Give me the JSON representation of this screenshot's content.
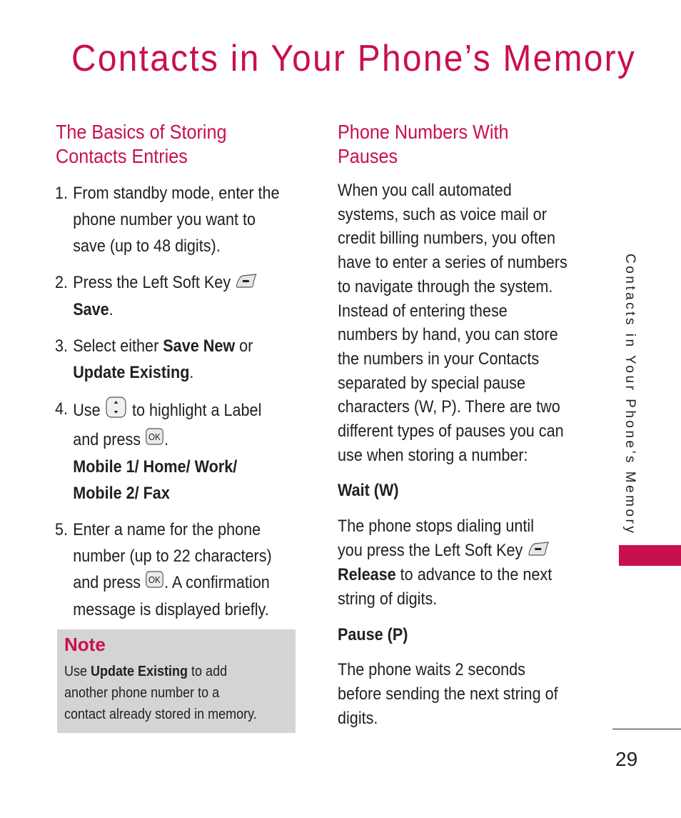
{
  "page": {
    "title": "Contacts in Your Phone’s Memory",
    "accent_color": "#c8104e",
    "side_tab": "Contacts in Your Phone’s Memory",
    "page_number": "29"
  },
  "left_section": {
    "heading_line1": "The Basics of Storing",
    "heading_line2": "Contacts Entries",
    "steps": [
      {
        "num": "1.",
        "lines": [
          "From standby mode, enter the",
          "phone number you want to",
          "save (up to 48 digits)."
        ]
      },
      {
        "num": "2.",
        "line1": "Press the Left Soft Key",
        "bold": "Save",
        "after": "."
      },
      {
        "num": "3.",
        "pre": "Select either ",
        "bold1": "Save New",
        "mid": " or",
        "bold2": "Update Existing",
        "after": "."
      },
      {
        "num": "4.",
        "pre": "Use",
        "post": "to highlight a Label",
        "line2_pre": "and press",
        "line2_post": ".",
        "labels_line1": "Mobile 1/ Home/ Work/",
        "labels_line2": "Mobile 2/ Fax"
      },
      {
        "num": "5.",
        "line1": "Enter a name for the phone",
        "line2": "number (up to 22 characters)",
        "line3_pre": "and press",
        "line3_post": ". A confirmation",
        "line4": "message is displayed briefly."
      }
    ],
    "note": {
      "title": "Note",
      "pre": "Use ",
      "bold": "Update Existing",
      "post": " to add",
      "line2": "another phone number to a",
      "line3": "contact already stored in memory."
    }
  },
  "right_section": {
    "heading_line1": "Phone Numbers With",
    "heading_line2": "Pauses",
    "intro_lines": [
      "When you call automated",
      "systems, such as voice mail or",
      "credit billing numbers, you often",
      "have to enter a series of numbers",
      "to navigate through the system.",
      "Instead of entering these",
      "numbers by hand, you can store",
      "the numbers in your Contacts",
      "separated by special pause",
      "characters (W, P). There are two",
      "different types of pauses you can",
      "use when storing a number:"
    ],
    "wait": {
      "heading": "Wait (W)",
      "line1": "The phone stops dialing until",
      "line2": "you press the Left Soft Key",
      "bold": "Release",
      "line3_post": " to advance to the next",
      "line4": "string of digits."
    },
    "pause": {
      "heading": "Pause (P)",
      "lines": [
        "The phone waits 2 seconds",
        "before sending the next string of",
        "digits."
      ]
    }
  },
  "icons": {
    "left_soft_key": "left-soft-key-icon",
    "nav_up_down": "navigation-up-down-key-icon",
    "ok_key": "ok-key-icon",
    "ok_label": "OK"
  }
}
